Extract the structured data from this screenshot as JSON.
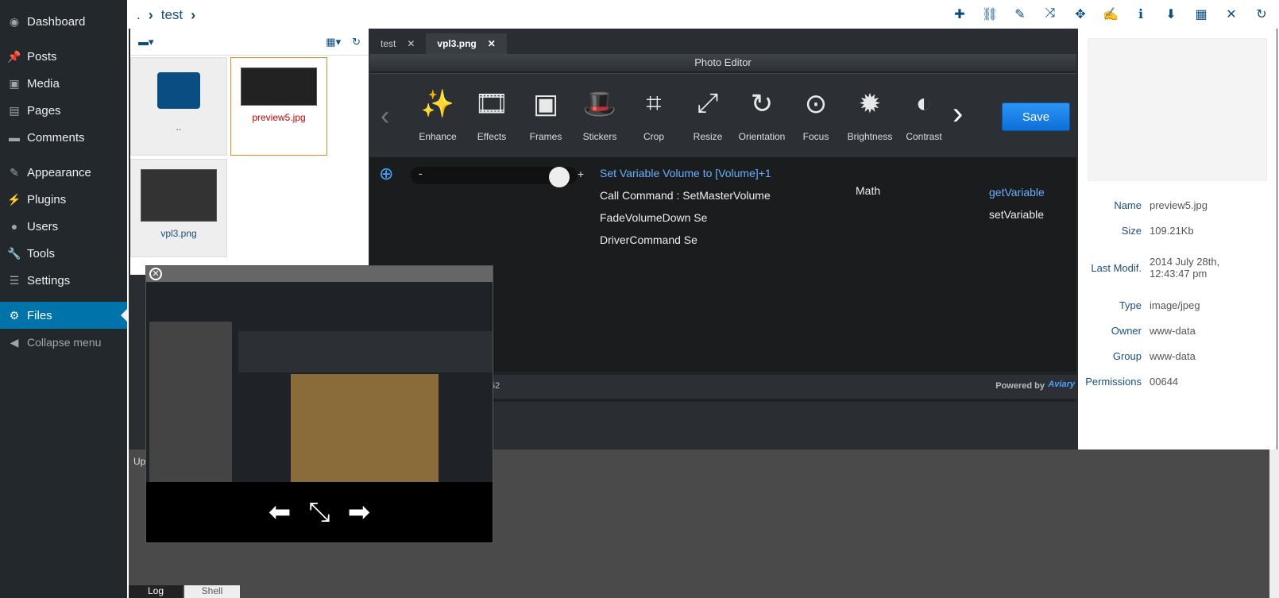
{
  "sidebar": {
    "items": [
      {
        "label": "Dashboard",
        "icon": "dashboard-icon",
        "glyph": "◉"
      },
      {
        "label": "Posts",
        "icon": "pin-icon",
        "glyph": "📌"
      },
      {
        "label": "Media",
        "icon": "media-icon",
        "glyph": "▣"
      },
      {
        "label": "Pages",
        "icon": "pages-icon",
        "glyph": "▤"
      },
      {
        "label": "Comments",
        "icon": "comment-icon",
        "glyph": "▬"
      },
      {
        "label": "Appearance",
        "icon": "brush-icon",
        "glyph": "✎"
      },
      {
        "label": "Plugins",
        "icon": "plug-icon",
        "glyph": "⚡"
      },
      {
        "label": "Users",
        "icon": "user-icon",
        "glyph": "●"
      },
      {
        "label": "Tools",
        "icon": "wrench-icon",
        "glyph": "🔧"
      },
      {
        "label": "Settings",
        "icon": "settings-icon",
        "glyph": "☰"
      },
      {
        "label": "Files",
        "icon": "gear-icon",
        "glyph": "⚙"
      },
      {
        "label": "Collapse menu",
        "icon": "collapse-icon",
        "glyph": "◀"
      }
    ]
  },
  "breadcrumb": {
    "root": ".",
    "folder": "test"
  },
  "files": [
    {
      "name": ".."
    },
    {
      "name": "preview5.jpg"
    },
    {
      "name": "vpl3.png"
    }
  ],
  "editor": {
    "tabs": [
      {
        "label": "test"
      },
      {
        "label": "vpl3.png"
      }
    ],
    "title": "Photo Editor",
    "tools": [
      "Enhance",
      "Effects",
      "Frames",
      "Stickers",
      "Crop",
      "Resize",
      "Orientation",
      "Focus",
      "Brightness",
      "Contrast"
    ],
    "save": "Save",
    "zoom_minus": "-",
    "zoom_plus": "+",
    "footer_left": "52",
    "footer_right": "Powered by",
    "brand": "Aviary",
    "canvas_lines": [
      "Set Variable Volume to [Volume]+1",
      "Call Command : SetMasterVolume",
      "FadeVolumeDown Se",
      "DriverCommand Se"
    ],
    "right_col": [
      "Math",
      "getVariable",
      "setVariable"
    ]
  },
  "info": {
    "rows": [
      {
        "k": "Name",
        "v": "preview5.jpg"
      },
      {
        "k": "Size",
        "v": "109.21Kb"
      },
      {
        "k": "Last Modif.",
        "v": "2014 July 28th, 12:43:47 pm"
      },
      {
        "k": "Type",
        "v": "image/jpeg"
      },
      {
        "k": "Owner",
        "v": "www-data"
      },
      {
        "k": "Group",
        "v": "www-data"
      },
      {
        "k": "Permissions",
        "v": "00644"
      }
    ]
  },
  "bottom": {
    "up_label": "Up",
    "log": "Log",
    "shell": "Shell"
  }
}
